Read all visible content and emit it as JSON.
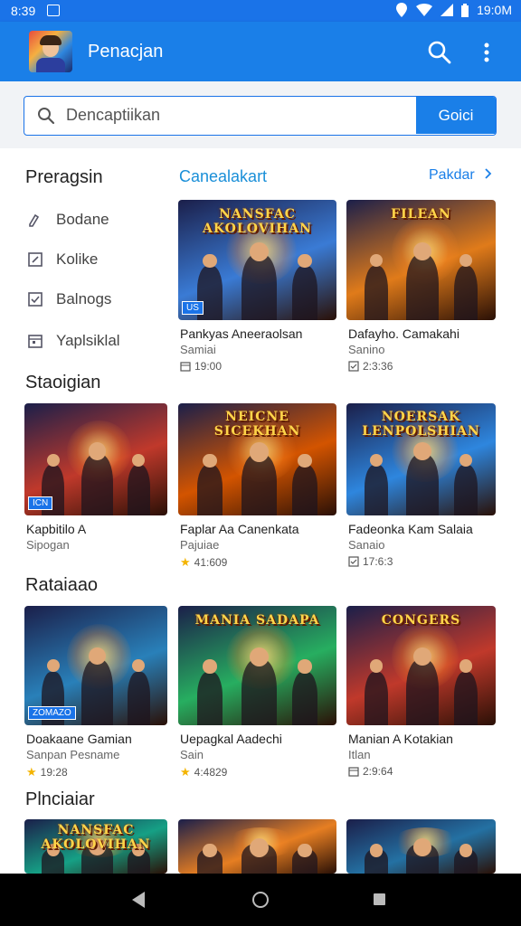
{
  "status_bar": {
    "time": "8:39",
    "battery_text": "19:0M"
  },
  "app_bar": {
    "title": "Penacjan"
  },
  "search": {
    "placeholder": "Dencaptiikan",
    "button_label": "Goici"
  },
  "sidebar": {
    "title": "Preragsin",
    "items": [
      {
        "label": "Bodane",
        "icon": "pencil-icon"
      },
      {
        "label": "Kolike",
        "icon": "edit-box-icon"
      },
      {
        "label": "Balnogs",
        "icon": "checkbox-icon"
      },
      {
        "label": "Yaplsiklal",
        "icon": "calendar-icon"
      }
    ]
  },
  "featured": {
    "title": "Canealakart",
    "more_label": "Pakdar",
    "more_icon": "chevron-right-icon"
  },
  "sections": {
    "second": "Staoigian",
    "third": "Rataiaao",
    "fourth": "Plnciaiar"
  },
  "cards": [
    {
      "name": "Pankyas Aneeraolsan",
      "sub": "Samiai",
      "meta": "19:00",
      "meta_icon": "calendar-icon",
      "logo": "NANSFAC AKOLOVIHAN",
      "badge": "US",
      "accent": "#3a7bd5"
    },
    {
      "name": "Dafayho. Camakahi",
      "sub": "Sanino",
      "meta": "2:3:36",
      "meta_icon": "checkbox-icon",
      "logo": "FILEAN",
      "badge": "",
      "accent": "#e07b1a"
    },
    {
      "name": "Kapbitilo A",
      "sub": "Sipogan",
      "meta": "",
      "meta_icon": "",
      "logo": "",
      "badge": "ICN",
      "accent": "#c0392b"
    },
    {
      "name": "Faplar Aa Canenkata",
      "sub": "Pajuiae",
      "meta": "41:609",
      "meta_icon": "star-icon",
      "logo": "NEICNE SICEKHAN",
      "badge": "",
      "accent": "#d35400"
    },
    {
      "name": "Fadeonka Kam Salaia",
      "sub": "Sanaio",
      "meta": "17:6:3",
      "meta_icon": "checkbox-icon",
      "logo": "NOERSAK LENPOLSHIAN",
      "badge": "",
      "accent": "#2e86de"
    },
    {
      "name": "Doakaane Gamian",
      "sub": "Sanpan Pesname",
      "meta": "19:28",
      "meta_icon": "star-icon",
      "logo": "",
      "badge": "ZOMAZO",
      "accent": "#2980b9"
    },
    {
      "name": "Uepagkal Aadechi",
      "sub": "Sain",
      "meta": "4:4829",
      "meta_icon": "star-icon",
      "logo": "MANIA SADAPA",
      "badge": "",
      "accent": "#27ae60"
    },
    {
      "name": "Manian A Kotakian",
      "sub": "Itlan",
      "meta": "2:9:64",
      "meta_icon": "calendar-icon",
      "logo": "CONGERS",
      "badge": "",
      "accent": "#c0392b"
    },
    {
      "name": "",
      "sub": "",
      "meta": "",
      "meta_icon": "",
      "logo": "NANSFAC AKOLOVIHAN",
      "badge": "",
      "accent": "#16a085"
    },
    {
      "name": "",
      "sub": "",
      "meta": "",
      "meta_icon": "",
      "logo": "",
      "badge": "",
      "accent": "#e67e22"
    },
    {
      "name": "",
      "sub": "",
      "meta": "",
      "meta_icon": "",
      "logo": "",
      "badge": "",
      "accent": "#2471a3"
    }
  ],
  "nav": {
    "back_icon": "back-triangle-icon",
    "home_icon": "home-circle-icon",
    "recents_icon": "recents-square-icon"
  }
}
